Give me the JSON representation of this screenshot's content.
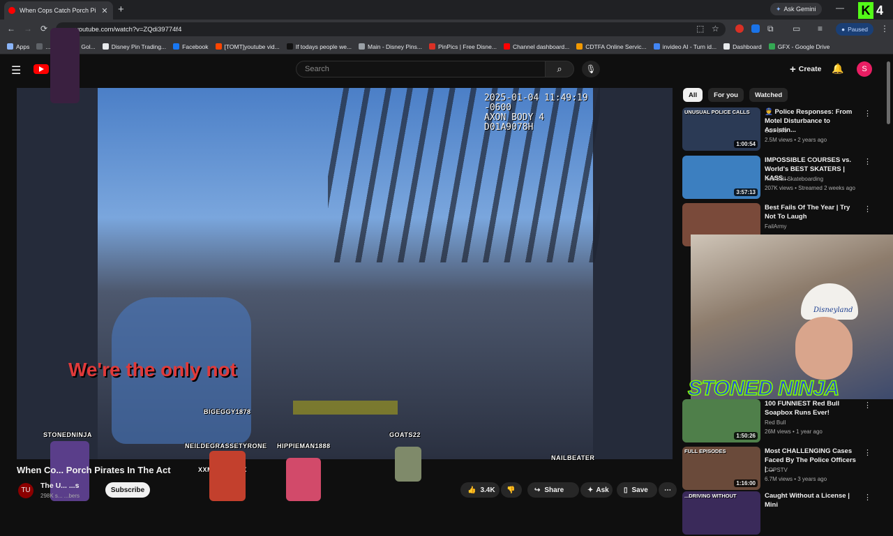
{
  "browser": {
    "tab_title": "When Cops Catch Porch Pi",
    "url": "youtube.com/watch?v=ZQdi39774f4",
    "ask_gemini": "Ask Gemini",
    "paused": "Paused",
    "profile_badge": "4",
    "bookmarks": [
      {
        "label": "Apps",
        "color": "#8ab4f8"
      },
      {
        "label": "...prehensive Gol...",
        "color": "#5f6368"
      },
      {
        "label": "Disney Pin Trading...",
        "color": "#e8eaed"
      },
      {
        "label": "Facebook",
        "color": "#1877f2"
      },
      {
        "label": "[TOMT]youtube vid...",
        "color": "#ff4500"
      },
      {
        "label": "If todays people we...",
        "color": "#111111"
      },
      {
        "label": "Main - Disney Pins...",
        "color": "#9aa0a6"
      },
      {
        "label": "PinPics | Free Disne...",
        "color": "#d93025"
      },
      {
        "label": "Channel dashboard...",
        "color": "#ff0000"
      },
      {
        "label": "CDTFA Online Servic...",
        "color": "#f29900"
      },
      {
        "label": "invideo AI - Turn id...",
        "color": "#4285f4"
      },
      {
        "label": "Dashboard",
        "color": "#e8eaed"
      },
      {
        "label": "GFX - Google Drive",
        "color": "#34a853"
      }
    ]
  },
  "youtube": {
    "search_placeholder": "Search",
    "create_label": "Create",
    "avatar_letter": "S"
  },
  "video": {
    "timestamp_line1": "2025-01-04 11:49:19 -0600",
    "timestamp_line2": "AXON BODY 4 D01A9078H",
    "caption": "We're the only not",
    "title": "When Co... Porch Pirates In The Act",
    "channel": "The U... ...s",
    "subscribers": "298K s... ...bers",
    "subscribe_label": "Subscribe",
    "likes": "3.4K",
    "share_label": "Share",
    "ask_label": "Ask",
    "save_label": "Save"
  },
  "chatters": [
    {
      "name": "BIGEGGY1878"
    },
    {
      "name": "STONEDNINJA"
    },
    {
      "name": "NEILDEGRASSETYRONE"
    },
    {
      "name": "HIPPIEMAN1888"
    },
    {
      "name": "GOATS22"
    },
    {
      "name": "XXMAMOTOXX"
    },
    {
      "name": "NAILBEATER"
    }
  ],
  "filters": [
    "All",
    "For you",
    "Watched"
  ],
  "recommendations": [
    {
      "title": "👮 Police Responses: From Motel Disturbance to Assistin...",
      "channel": "COPSTV",
      "meta": "2.5M views • 2 years ago",
      "duration": "1:00:54",
      "thumb_label": "UNUSUAL POLICE CALLS",
      "thumb_color": "#2b3a55"
    },
    {
      "title": "IMPOSSIBLE COURSES vs. World's BEST SKATERS | KASS...",
      "channel": "Red Bull Skateboarding",
      "meta": "207K views • Streamed 2 weeks ago",
      "duration": "3:57:13",
      "thumb_label": "",
      "thumb_color": "#3c7fc0"
    },
    {
      "title": "Best Fails Of The Year | Try Not To Laugh",
      "channel": "FailArmy",
      "meta": "",
      "duration": "",
      "thumb_label": "",
      "thumb_color": "#7a4a3a"
    },
    {
      "title": "100 FUNNIEST Red Bull Soapbox Runs Ever!",
      "channel": "Red Bull",
      "meta": "26M views • 1 year ago",
      "duration": "1:50:26",
      "thumb_label": "",
      "thumb_color": "#4f7f4a"
    },
    {
      "title": "Most CHALLENGING Cases Faced By The Police Officers | ...",
      "channel": "COPSTV",
      "meta": "6.7M views • 3 years ago",
      "duration": "1:16:00",
      "thumb_label": "FULL EPISODES",
      "thumb_color": "#6a4a3a"
    },
    {
      "title": "Caught Without a License | Mini",
      "channel": "",
      "meta": "",
      "duration": "",
      "thumb_label": "...DRIVING WITHOUT",
      "thumb_color": "#3a2a5a"
    }
  ],
  "overlay": {
    "stoned_ninja": "STONED NINJA",
    "hat_text": "Disneyland"
  }
}
